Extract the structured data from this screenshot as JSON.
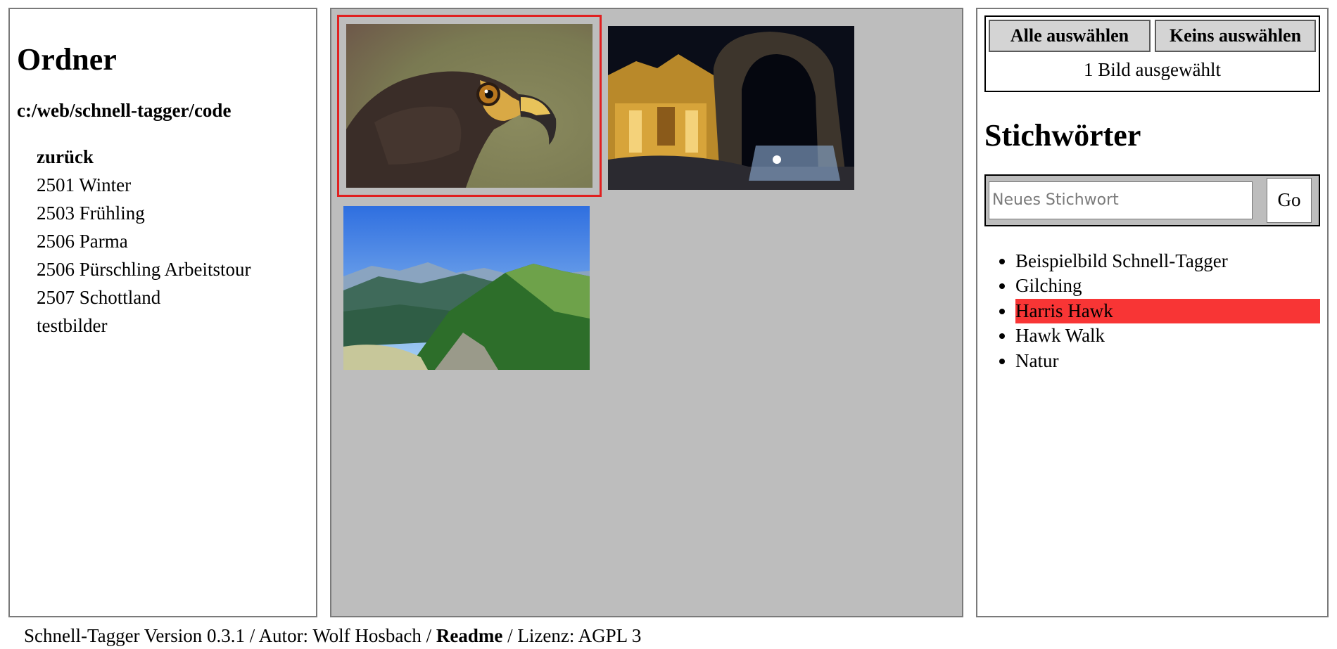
{
  "folders": {
    "title": "Ordner",
    "path": "c:/web/schnell-tagger/code",
    "back_label": "zurück",
    "items": [
      "2501 Winter",
      "2503 Frühling",
      "2506 Parma",
      "2506 Pürschling Arbeitstour",
      "2507 Schottland",
      "testbilder"
    ]
  },
  "selection": {
    "select_all_label": "Alle auswählen",
    "select_none_label": "Keins auswählen",
    "status": "1 Bild ausgewählt"
  },
  "keywords": {
    "title": "Stichwörter",
    "input_placeholder": "Neues Stichwort",
    "go_label": "Go",
    "items": [
      "Beispielbild Schnell-Tagger",
      "Gilching",
      "Harris Hawk",
      "Hawk Walk",
      "Natur"
    ],
    "active_index": 2,
    "active_color": "#f83535"
  },
  "images": [
    {
      "name": "hawk-photo",
      "selected": true
    },
    {
      "name": "night-arch-photo",
      "selected": false
    },
    {
      "name": "mountain-photo",
      "selected": false
    }
  ],
  "footer": {
    "version_text": "Schnell-Tagger Version 0.3.1",
    "sep1": " / ",
    "author_text": "Autor: Wolf Hosbach",
    "sep2": " / ",
    "readme_label": "Readme",
    "sep3": " / ",
    "license_text": "Lizenz: AGPL 3"
  },
  "colors": {
    "grid_bg": "#bdbdbd",
    "selection_outline": "#e02020",
    "button_bg": "#d4d4d4"
  }
}
